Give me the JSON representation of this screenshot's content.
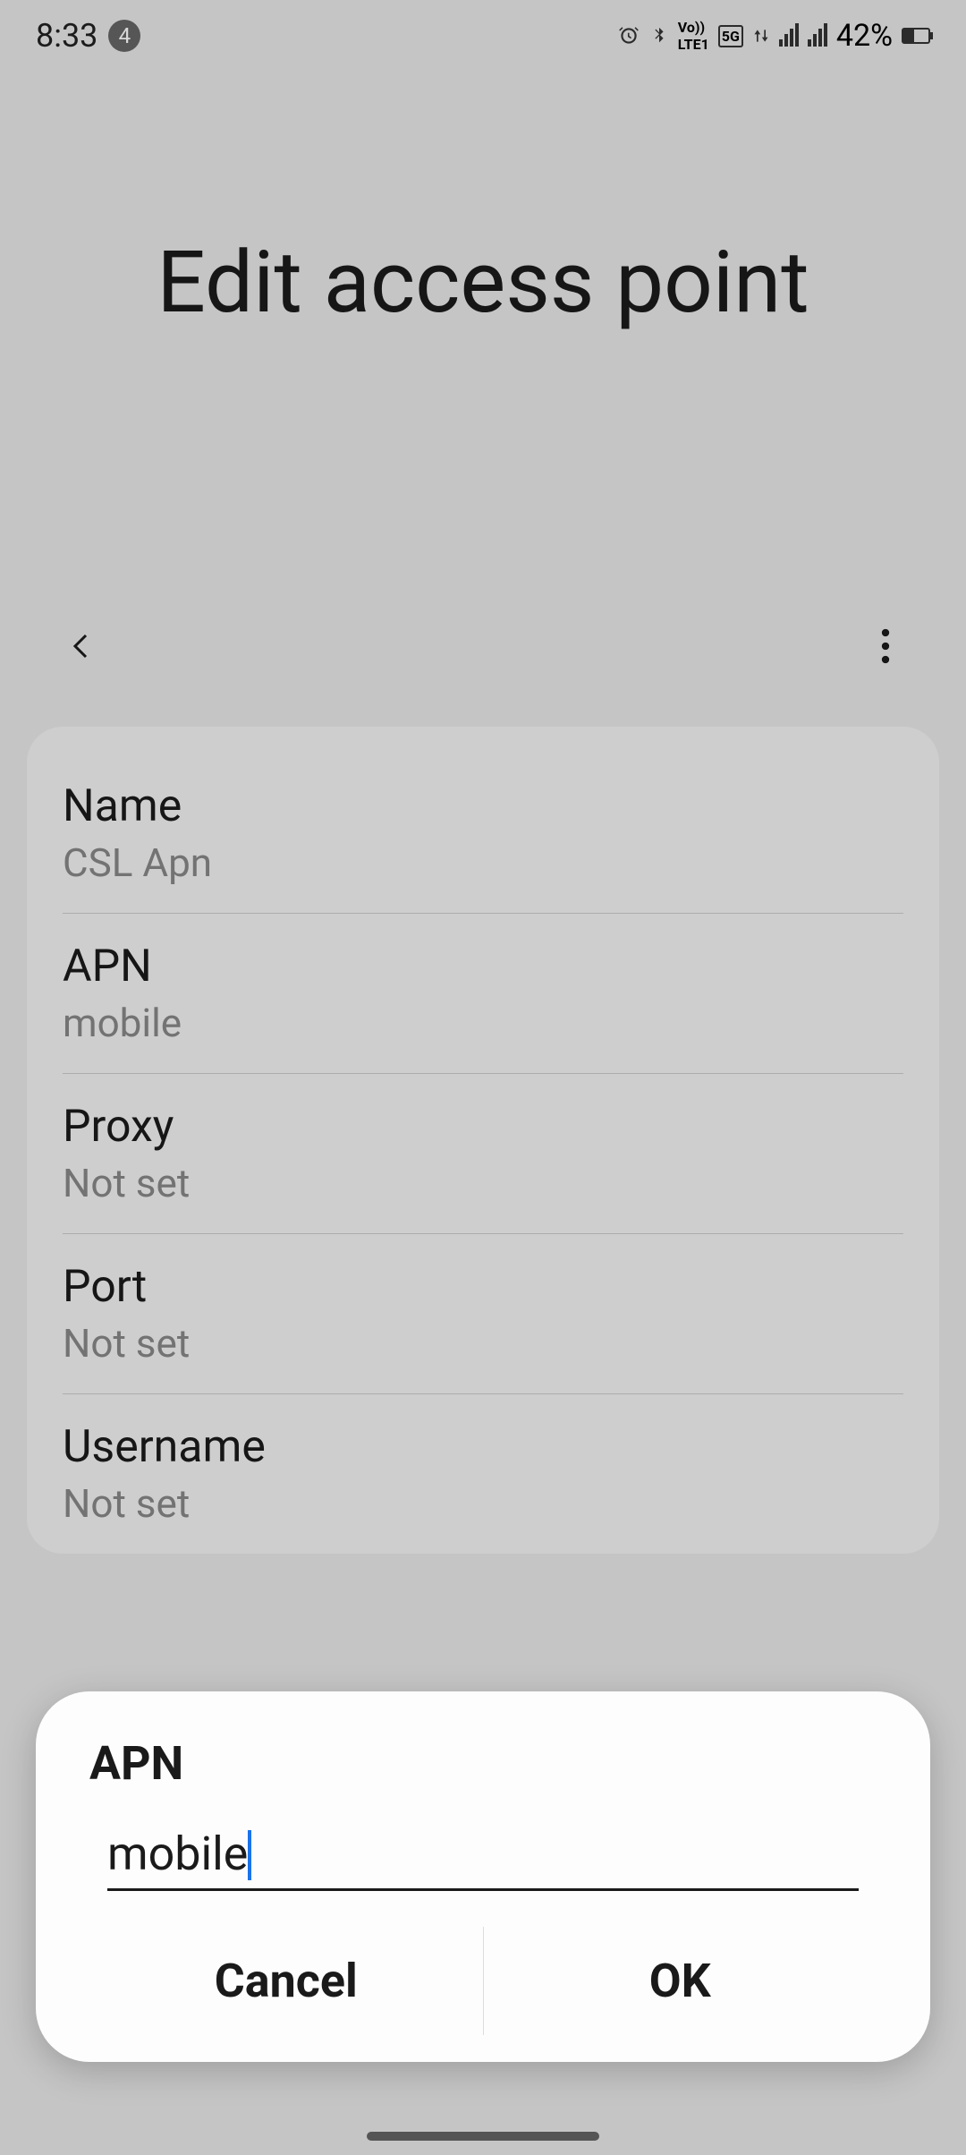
{
  "status": {
    "time": "8:33",
    "notif_count": "4",
    "battery": "42%"
  },
  "page": {
    "title": "Edit access point"
  },
  "list": [
    {
      "label": "Name",
      "value": "CSL Apn"
    },
    {
      "label": "APN",
      "value": "mobile"
    },
    {
      "label": "Proxy",
      "value": "Not set"
    },
    {
      "label": "Port",
      "value": "Not set"
    },
    {
      "label": "Username",
      "value": "Not set"
    }
  ],
  "dialog": {
    "title": "APN",
    "value": "mobile",
    "cancel": "Cancel",
    "ok": "OK"
  }
}
